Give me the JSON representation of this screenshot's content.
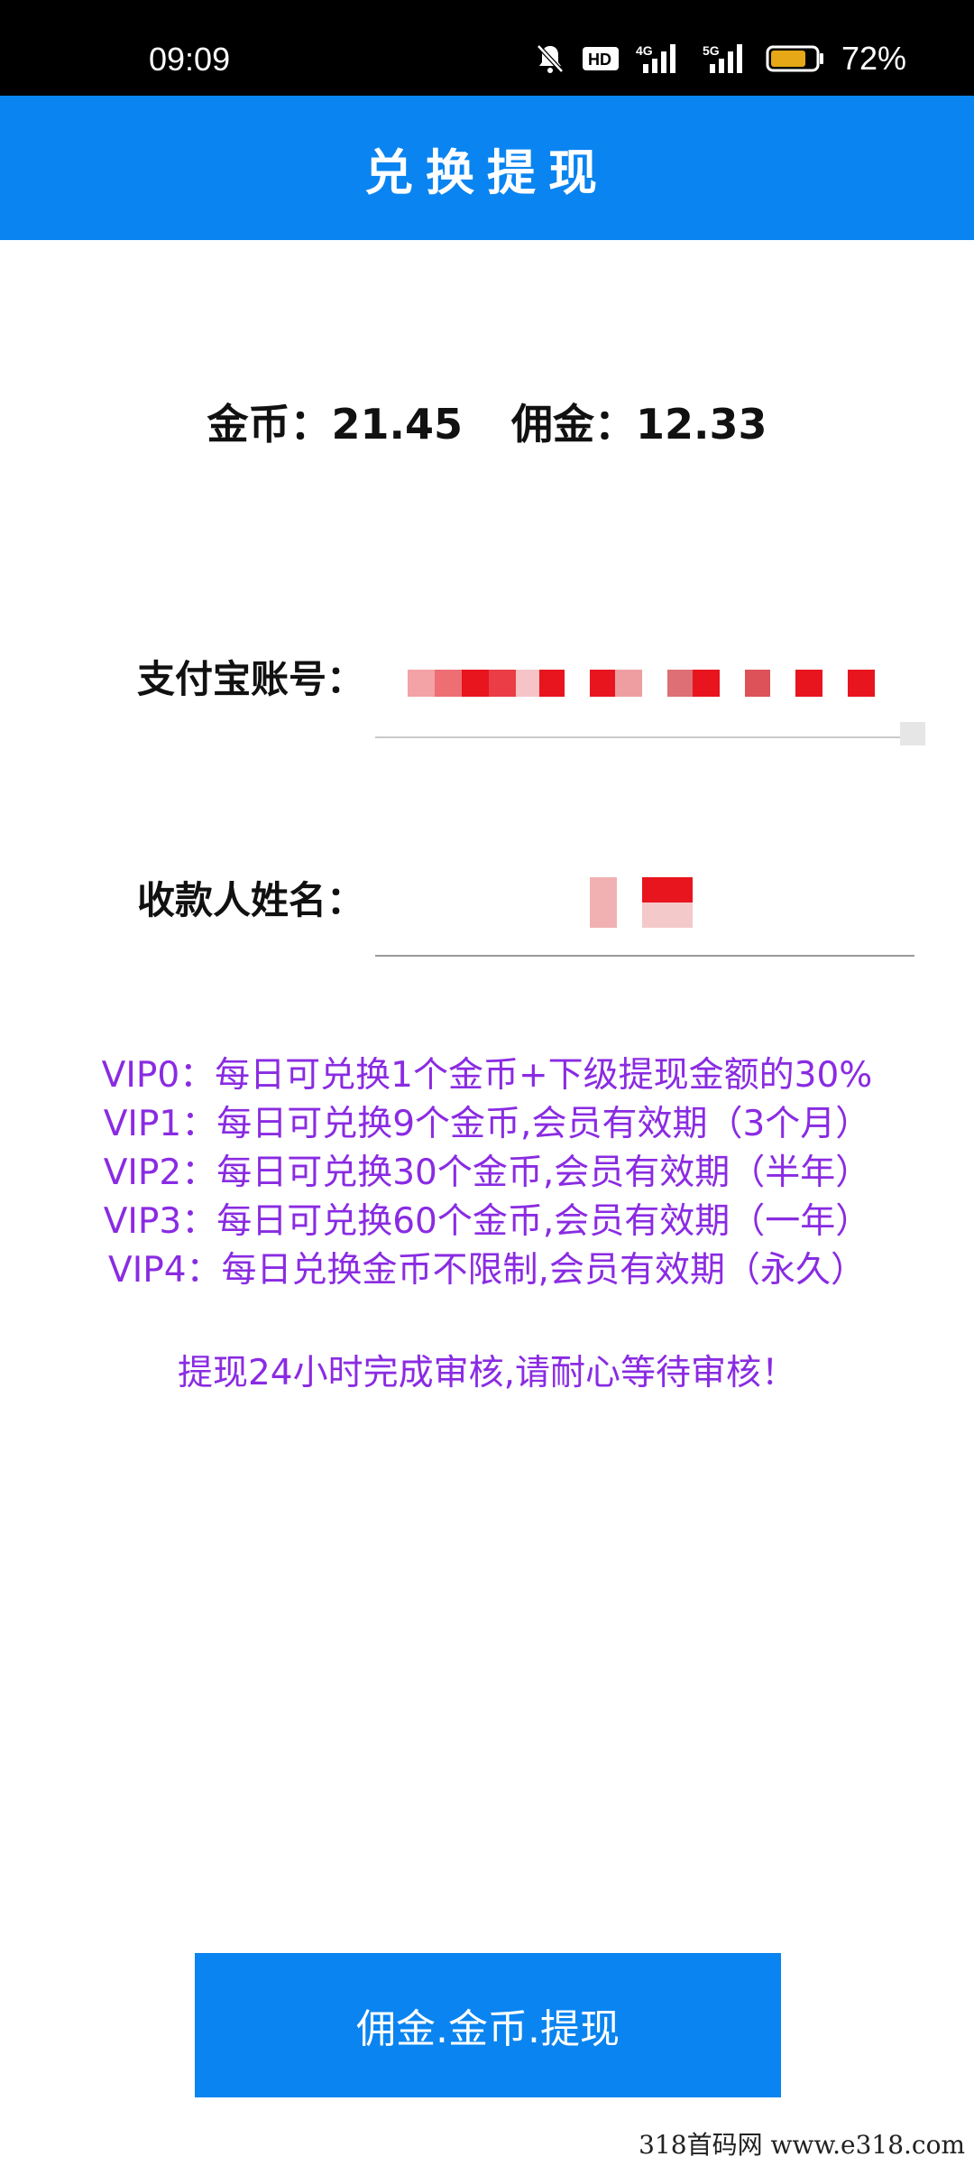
{
  "status_bar": {
    "time": "09:09",
    "network_4g": "4G",
    "network_5g": "5G",
    "hd_badge": "HD",
    "battery_percent": "72%",
    "icons": [
      "bell-muted-icon",
      "hd-icon",
      "signal-4g-icon",
      "signal-5g-icon",
      "battery-icon"
    ]
  },
  "header": {
    "title": "兑换提现"
  },
  "balance": {
    "coins_label": "金币：",
    "coins_value": "21.45",
    "commission_label": "佣金：",
    "commission_value": "12.33"
  },
  "form": {
    "alipay_label": "支付宝账号：",
    "alipay_value": "",
    "payee_label": "收款人姓名：",
    "payee_value": ""
  },
  "vip_rules": [
    "VIP0：每日可兑换1个金币+下级提现金额的30%",
    "VIP1：每日可兑换9个金币,会员有效期（3个月）",
    "VIP2：每日可兑换30个金币,会员有效期（半年）",
    "VIP3：每日可兑换60个金币,会员有效期（一年）",
    "VIP4：每日兑换金币不限制,会员有效期（永久）"
  ],
  "notice": "提现24小时完成审核,请耐心等待审核！",
  "actions": {
    "withdraw_label": "佣金.金币.提现"
  },
  "watermark": "318首码网  www.e318.com",
  "colors": {
    "primary": "#0a84f0",
    "vip_text": "#8a2be2",
    "redaction": "#e8141e"
  }
}
